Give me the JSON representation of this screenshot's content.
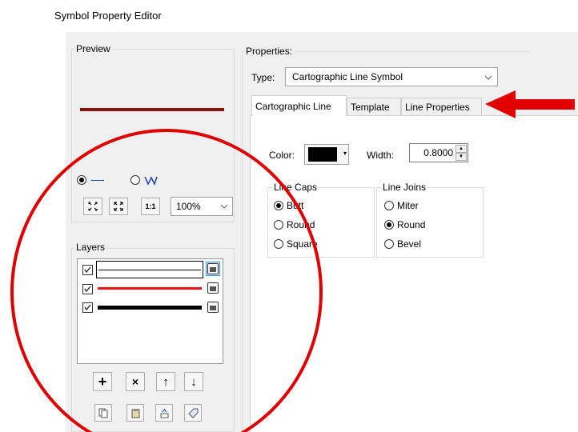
{
  "window": {
    "title": "Symbol Property Editor"
  },
  "preview": {
    "label": "Preview",
    "line_color": "#8b1010"
  },
  "line_type_radio": {
    "selected": "solid"
  },
  "zoom": {
    "value": "100%"
  },
  "layers": {
    "label": "Layers",
    "items": [
      {
        "checked": true,
        "color": "#ffffff",
        "selected": true
      },
      {
        "checked": true,
        "color": "#ee1111",
        "selected": false
      },
      {
        "checked": true,
        "color": "#000000",
        "selected": false
      }
    ]
  },
  "layer_buttons": [
    "add-layer",
    "remove-layer",
    "move-up",
    "move-down"
  ],
  "bottom_buttons": [
    "copy-icon",
    "paste-icon",
    "export-icon",
    "tag-icon"
  ],
  "properties": {
    "label": "Properties:",
    "type_label": "Type:",
    "type_value": "Cartographic Line Symbol",
    "tabs": [
      "Cartographic Line",
      "Template",
      "Line Properties"
    ],
    "active_tab": "Cartographic Line",
    "color_label": "Color:",
    "color_value": "#000000",
    "width_label": "Width:",
    "width_value": "0.8000",
    "line_caps": {
      "label": "Line Caps",
      "options": [
        "Butt",
        "Round",
        "Square"
      ],
      "selected": "Butt"
    },
    "line_joins": {
      "label": "Line Joins",
      "options": [
        "Miter",
        "Round",
        "Bevel"
      ],
      "selected": "Round"
    }
  },
  "annotations": {
    "circle_color": "#e00000",
    "arrow_color": "#e00000"
  }
}
